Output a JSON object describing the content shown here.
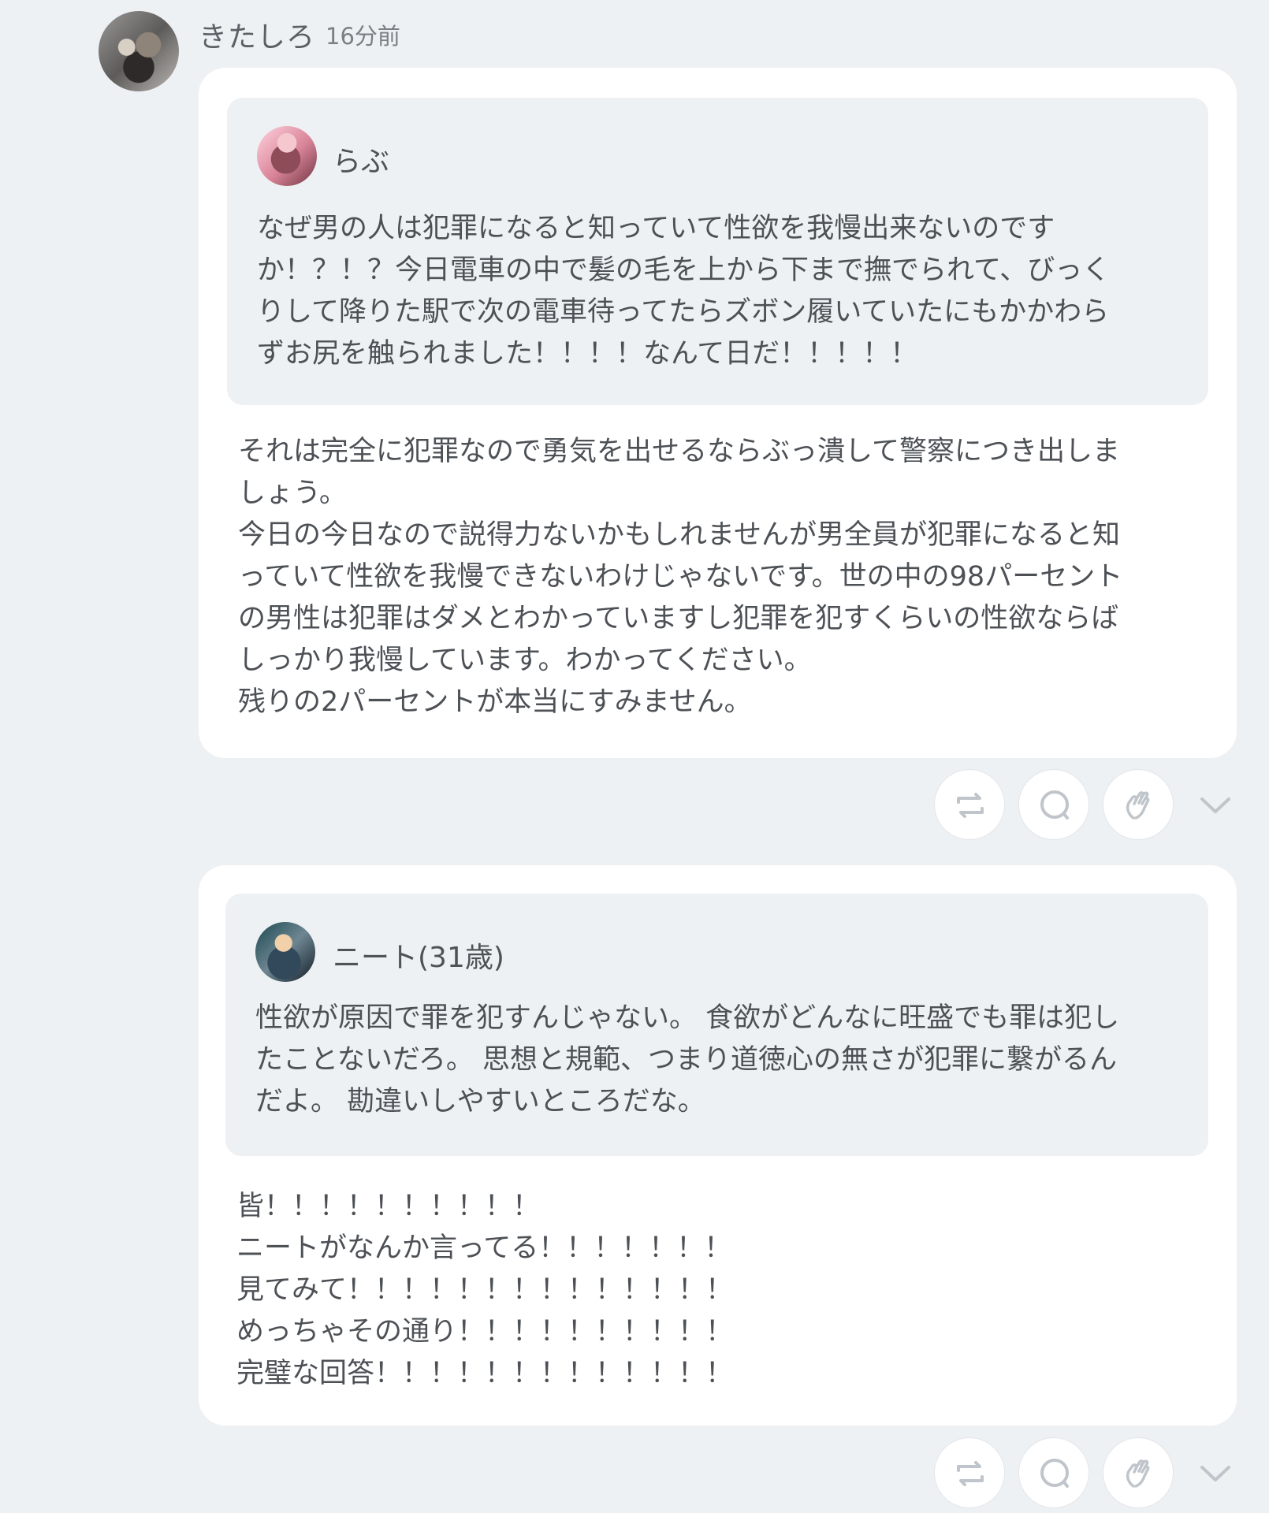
{
  "header": {
    "user_name": "きたしろ",
    "time": "16分前"
  },
  "posts": [
    {
      "quote": {
        "author": "らぶ",
        "text": "なぜ男の人は犯罪になると知っていて性欲を我慢出来ないのです\nか！？！？今日電車の中で髪の毛を上から下まで撫でられて、びっく\nりして降りた駅で次の電車待ってたらズボン履いていたにもかかわら\nずお尻を触られました！！！！なんて日だ！！！！！"
      },
      "reply": "それは完全に犯罪なので勇気を出せるならぶっ潰して警察につき出しま\nしょう。\n今日の今日なので説得力ないかもしれませんが男全員が犯罪になると知\nっていて性欲を我慢できないわけじゃないです。世の中の98パーセント\nの男性は犯罪はダメとわかっていますし犯罪を犯すくらいの性欲ならば\nしっかり我慢しています。わかってください。\n残りの2パーセントが本当にすみません。"
    },
    {
      "quote": {
        "author": "ニート(31歳)",
        "text": "性欲が原因で罪を犯すんじゃない。 食欲がどんなに旺盛でも罪は犯し\nたことないだろ。 思想と規範、つまり道徳心の無さが犯罪に繋がるん\nだよ。 勘違いしやすいところだな。"
      },
      "reply": "皆！！！！！！！！！！\nニートがなんか言ってる！！！！！！！\n見てみて！！！！！！！！！！！！！！\nめっちゃその通り！！！！！！！！！！\n完璧な回答！！！！！！！！！！！！！"
    }
  ],
  "icons": {
    "repost": "repost-icon",
    "comment": "comment-icon",
    "clap": "clap-icon",
    "more": "chevron-down-icon"
  },
  "colors": {
    "background": "#eef1f4",
    "card": "#ffffff",
    "quote_background": "#eef1f4",
    "text": "#4d5156",
    "icon": "#c0c5cb"
  }
}
